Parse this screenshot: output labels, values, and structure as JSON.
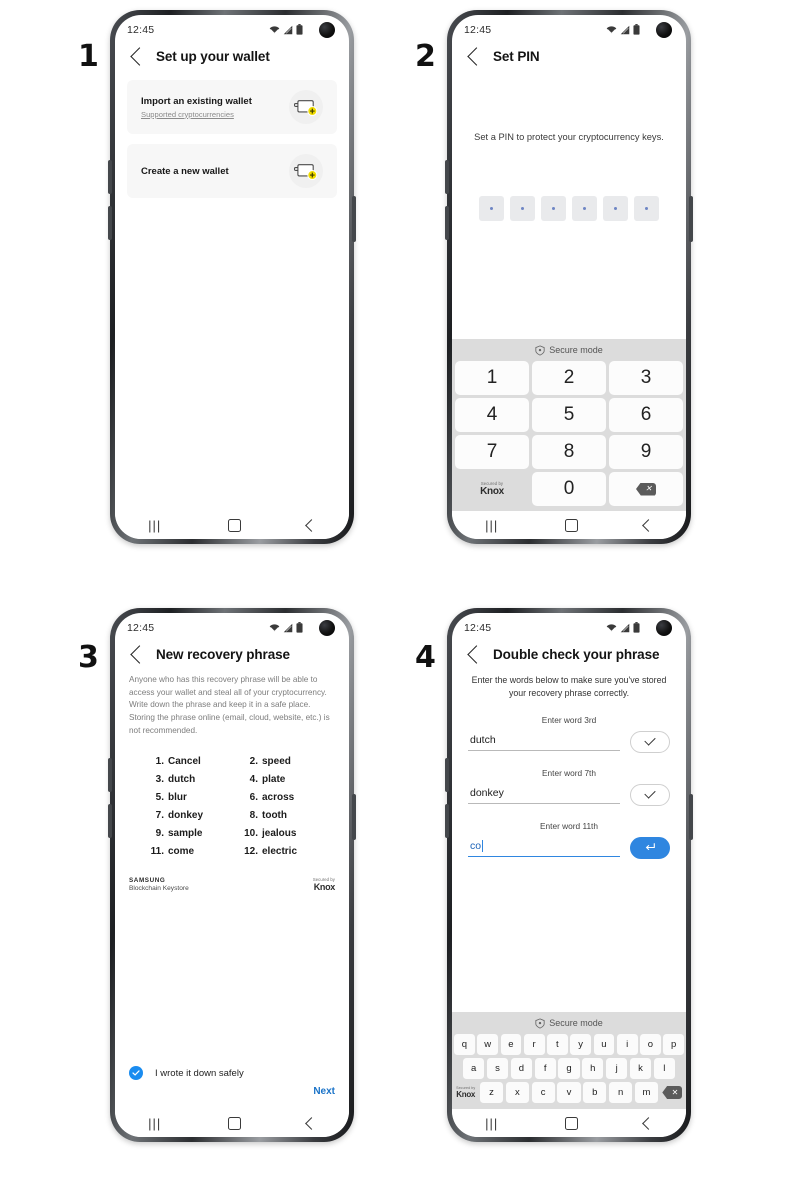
{
  "steps": [
    {
      "number": "1"
    },
    {
      "number": "2"
    },
    {
      "number": "3"
    },
    {
      "number": "4"
    }
  ],
  "status_bar": {
    "clock": "12:45",
    "icons": [
      "wifi-icon",
      "signal-icon",
      "battery-icon"
    ]
  },
  "nav_bar": {
    "recents": "|||",
    "home": "home-square",
    "back": "back-chevron"
  },
  "colors": {
    "accent_blue": "#2f86e0",
    "link_blue": "#1a73c8",
    "checkbox_blue": "#1a8cf0",
    "wallet_yellow": "#f2dd00",
    "keypad_bg": "#dcdcdc",
    "card_bg": "#f7f7f7",
    "pin_box_bg": "#e9eaec"
  },
  "screen1": {
    "title": "Set up your wallet",
    "cards": [
      {
        "title": "Import an existing wallet",
        "subtitle": "Supported cryptocurrencies",
        "icon": "wallet-add-icon"
      },
      {
        "title": "Create a new wallet",
        "subtitle": "",
        "icon": "wallet-add-icon"
      }
    ]
  },
  "screen2": {
    "title": "Set PIN",
    "description": "Set a PIN to protect your cryptocurrency keys.",
    "pin_length": 6,
    "secure_mode_label": "Secure mode",
    "keypad": [
      "1",
      "2",
      "3",
      "4",
      "5",
      "6",
      "7",
      "8",
      "9",
      "",
      "0",
      ""
    ],
    "knox": {
      "secured_by": "Secured by",
      "name": "Knox"
    },
    "backspace": "backspace-icon"
  },
  "screen3": {
    "title": "New recovery phrase",
    "warning": "Anyone who has this recovery phrase will be able to access your wallet and steal all of your cryptocurrency. Write down the phrase and keep it in a safe place. Storing the phrase online (email, cloud, website, etc.) is not recommended.",
    "words": [
      {
        "n": "1.",
        "w": "Cancel"
      },
      {
        "n": "2.",
        "w": "speed"
      },
      {
        "n": "3.",
        "w": "dutch"
      },
      {
        "n": "4.",
        "w": "plate"
      },
      {
        "n": "5.",
        "w": "blur"
      },
      {
        "n": "6.",
        "w": "across"
      },
      {
        "n": "7.",
        "w": "donkey"
      },
      {
        "n": "8.",
        "w": "tooth"
      },
      {
        "n": "9.",
        "w": "sample"
      },
      {
        "n": "10.",
        "w": "jealous"
      },
      {
        "n": "11.",
        "w": "come"
      },
      {
        "n": "12.",
        "w": "electric"
      }
    ],
    "brand": {
      "samsung": "SAMSUNG",
      "product": "Blockchain Keystore"
    },
    "knox": {
      "secured_by": "Secured by",
      "name": "Knox"
    },
    "confirm_label": "I wrote it down safely",
    "confirm_checked": true,
    "next_label": "Next"
  },
  "screen4": {
    "title": "Double check your phrase",
    "description": "Enter the words below to make sure you've stored your recovery phrase correctly.",
    "fields": [
      {
        "label": "Enter word 3rd",
        "value": "dutch",
        "placeholder": "",
        "state": "confirmed",
        "button": "check-icon"
      },
      {
        "label": "Enter word 7th",
        "value": "donkey",
        "placeholder": "",
        "state": "confirmed",
        "button": "check-icon"
      },
      {
        "label": "Enter word 11th",
        "value": "co",
        "placeholder": "",
        "state": "active",
        "button": "enter-icon"
      }
    ],
    "secure_mode_label": "Secure mode",
    "keyboard": {
      "row1": [
        "q",
        "w",
        "e",
        "r",
        "t",
        "y",
        "u",
        "i",
        "o",
        "p"
      ],
      "row2": [
        "a",
        "s",
        "d",
        "f",
        "g",
        "h",
        "j",
        "k",
        "l"
      ],
      "row3": [
        "z",
        "x",
        "c",
        "v",
        "b",
        "n",
        "m"
      ]
    },
    "knox": {
      "secured_by": "Secured by",
      "name": "Knox"
    },
    "backspace": "backspace-icon"
  }
}
